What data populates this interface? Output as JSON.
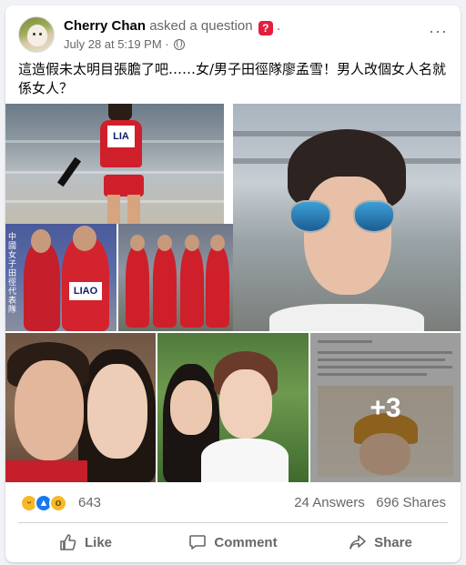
{
  "post": {
    "author": "Cherry Chan",
    "action": "asked a question",
    "question_badge": "?",
    "trailing": ".",
    "date": "July 28 at 5:19 PM",
    "separator": "·",
    "more": "···",
    "text": "這造假未太明目張膽了吧……女/男子田徑隊廖孟雪！男人改個女人名就係女人？"
  },
  "photos": {
    "bib_a": "LIA",
    "bib_b": "LIAO",
    "vertical_caption": "中國女子田徑代表隊",
    "more_count": "+3"
  },
  "footer": {
    "reaction_count": "643",
    "answers": "24 Answers",
    "shares": "696 Shares",
    "like_label": "Like",
    "comment_label": "Comment",
    "share_label": "Share"
  },
  "reactions": [
    "haha",
    "like",
    "wow"
  ],
  "colors": {
    "brand": "#1877f2",
    "question_badge": "#e41e3f",
    "shirt_red": "#cf1f2a"
  }
}
